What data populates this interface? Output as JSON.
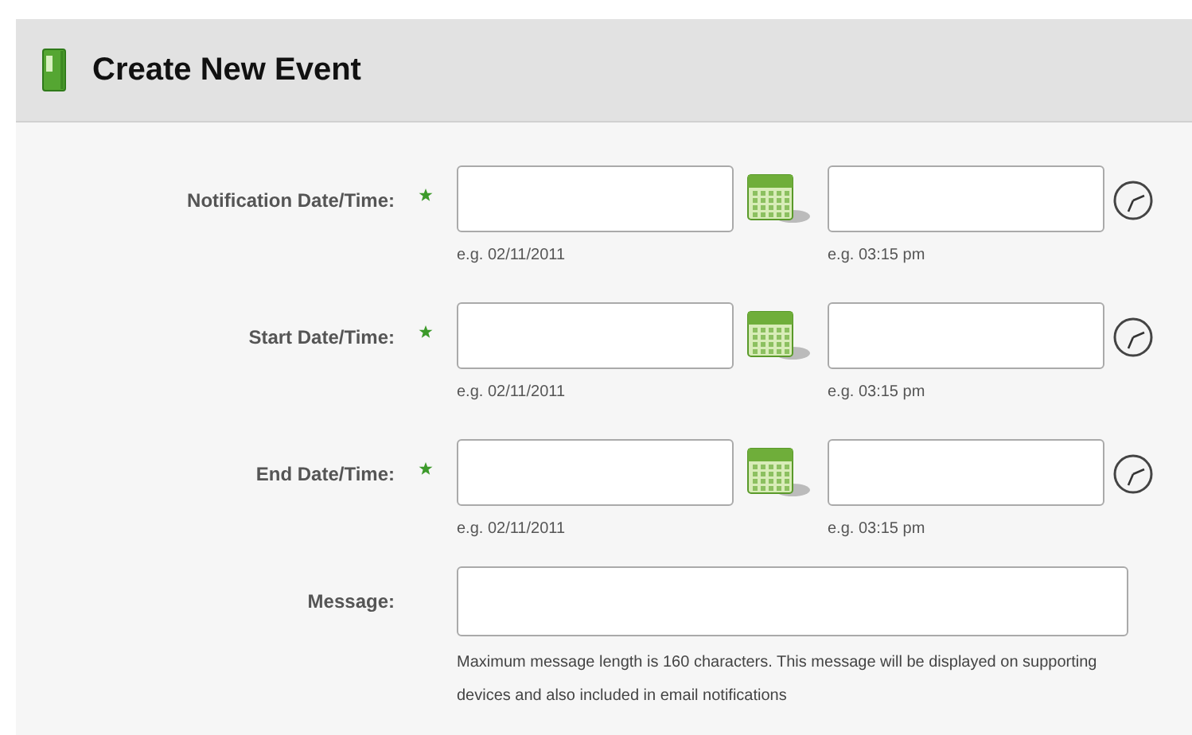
{
  "header": {
    "title": "Create New Event"
  },
  "datetime_rows": [
    {
      "label": "Notification Date/Time:",
      "required": true,
      "date_hint": "e.g. 02/11/2011",
      "time_hint": "e.g. 03:15 pm"
    },
    {
      "label": "Start Date/Time:",
      "required": true,
      "date_hint": "e.g. 02/11/2011",
      "time_hint": "e.g. 03:15 pm"
    },
    {
      "label": "End Date/Time:",
      "required": true,
      "date_hint": "e.g. 02/11/2011",
      "time_hint": "e.g. 03:15 pm"
    }
  ],
  "message": {
    "label": "Message:",
    "help": "Maximum message length is 160 characters. This message will be displayed on supporting devices and also included in email notifications"
  }
}
